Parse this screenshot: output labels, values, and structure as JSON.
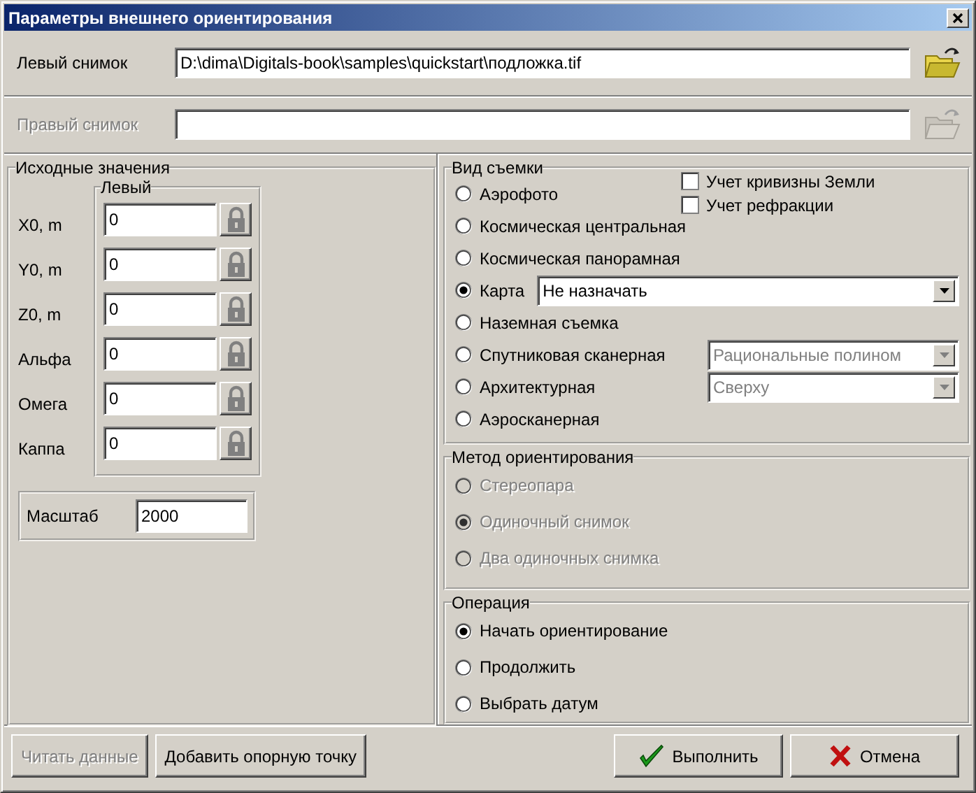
{
  "window": {
    "title": "Параметры внешнего ориентирования"
  },
  "files": [
    {
      "label": "Левый снимок",
      "value": "D:\\dima\\Digitals-book\\samples\\quickstart\\подложка.tif",
      "disabled": false
    },
    {
      "label": "Правый снимок",
      "disabled": true
    }
  ],
  "initial_values": {
    "title": "Исходные значения",
    "column_title": "Левый",
    "rows": [
      {
        "label": "X0, m",
        "value": "0"
      },
      {
        "label": "Y0, m",
        "value": "0"
      },
      {
        "label": "Z0, m",
        "value": "0"
      },
      {
        "label": "Альфа",
        "value": "0"
      },
      {
        "label": "Омега",
        "value": "0"
      },
      {
        "label": "Каппа",
        "value": "0"
      }
    ],
    "scale": {
      "label": "Масштаб",
      "value": "2000"
    }
  },
  "shooting_type": {
    "title": "Вид съемки",
    "checkboxes": [
      {
        "label": "Учет кривизны Земли",
        "checked": false
      },
      {
        "label": "Учет рефракции",
        "checked": false
      }
    ],
    "options": [
      {
        "label": "Аэрофото",
        "selected": false
      },
      {
        "label": "Космическая центральная",
        "selected": false
      },
      {
        "label": "Космическая панорамная",
        "selected": false
      },
      {
        "label": "Карта",
        "selected": true,
        "combo": {
          "value": "Не назначать",
          "disabled": false,
          "wide": true
        }
      },
      {
        "label": "Наземная съемка",
        "selected": false
      },
      {
        "label": "Спутниковая сканерная",
        "selected": false,
        "combo": {
          "value": "Рациональные полином",
          "disabled": true,
          "wide": false
        }
      },
      {
        "label": "Архитектурная",
        "selected": false,
        "combo": {
          "value": "Сверху",
          "disabled": true,
          "wide": false
        }
      },
      {
        "label": "Аэросканерная",
        "selected": false
      }
    ]
  },
  "method": {
    "title": "Метод ориентирования",
    "disabled": true,
    "options": [
      {
        "label": "Стереопара",
        "selected": false
      },
      {
        "label": "Одиночный снимок",
        "selected": true
      },
      {
        "label": "Два одиночных снимка",
        "selected": false
      }
    ]
  },
  "operation": {
    "title": "Операция",
    "disabled": false,
    "options": [
      {
        "label": "Начать ориентирование",
        "selected": true
      },
      {
        "label": "Продолжить",
        "selected": false
      },
      {
        "label": "Выбрать датум",
        "selected": false
      }
    ]
  },
  "buttons": [
    {
      "label": "Читать данные",
      "kind": "plain",
      "disabled": true
    },
    {
      "label": "Добавить опорную точку",
      "kind": "plain",
      "disabled": false
    },
    {
      "label": "Выполнить",
      "kind": "ok",
      "disabled": false
    },
    {
      "label": "Отмена",
      "kind": "cancel",
      "disabled": false
    }
  ]
}
